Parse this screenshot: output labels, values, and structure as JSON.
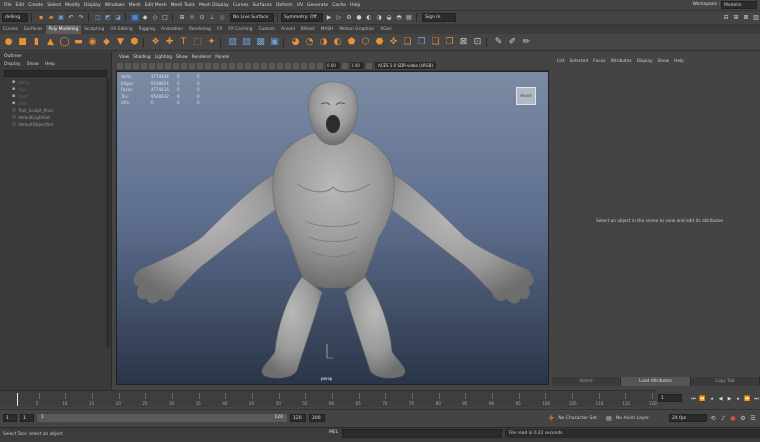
{
  "menubar": {
    "items": [
      "File",
      "Edit",
      "Create",
      "Select",
      "Modify",
      "Display",
      "Windows",
      "Mesh",
      "Edit Mesh",
      "Mesh Tools",
      "Mesh Display",
      "Curves",
      "Surfaces",
      "Deform",
      "UV",
      "Generate",
      "Cache",
      "Help"
    ],
    "workspace_label": "Workspace :",
    "workspace_value": "Modelin"
  },
  "statusline": {
    "mode": "delling",
    "live_surface": "No Live Surface",
    "symmetry": "Symmetry: Off",
    "sign_in": "Sign In"
  },
  "shelf_tabs": [
    "Curves",
    "Surfaces",
    "Poly Modeling",
    "Sculpting",
    "UV Editing",
    "Rigging",
    "Animation",
    "Rendering",
    "FX",
    "FX Caching",
    "Custom",
    "Arnold",
    "Bifrost",
    "MASH",
    "Motion Graphics",
    "XGen"
  ],
  "shelf_active": "Poly Modeling",
  "outliner": {
    "title": "Outliner",
    "menu": [
      "Display",
      "Show",
      "Help"
    ],
    "items": [
      {
        "label": "persp",
        "dim": true
      },
      {
        "label": "top",
        "dim": true
      },
      {
        "label": "front",
        "dim": true
      },
      {
        "label": "side",
        "dim": true
      },
      {
        "label": "Troll_Sculpt_final",
        "dim": false
      },
      {
        "label": "defaultLightSet",
        "dim": false
      },
      {
        "label": "defaultObjectSet",
        "dim": false
      }
    ]
  },
  "viewport": {
    "menu": [
      "View",
      "Shading",
      "Lighting",
      "Show",
      "Renderer",
      "Panels"
    ],
    "field1": "0.00",
    "field2": "1.00",
    "camera": "ACES 1.0 SDR-video (sRGB)",
    "hud": [
      {
        "label": "Verts:",
        "value": "4774404",
        "sel": "0",
        "z": "0"
      },
      {
        "label": "Edges:",
        "value": "9548824",
        "sel": "0",
        "z": "0"
      },
      {
        "label": "Faces:",
        "value": "4774416",
        "sel": "0",
        "z": "0"
      },
      {
        "label": "Tris:",
        "value": "9548832",
        "sel": "0",
        "z": "0"
      },
      {
        "label": "UVs:",
        "value": "0",
        "sel": "0",
        "z": "0"
      }
    ],
    "viewcube_label": "FRONT",
    "camera_label": "persp"
  },
  "attribute_editor": {
    "menu": [
      "List",
      "Selected",
      "Focus",
      "Attributes",
      "Display",
      "Show",
      "Help"
    ],
    "message": "Select an object in the scene to view and edit its attributes",
    "buttons": [
      "Select",
      "Load Attributes",
      "Copy Tab"
    ],
    "active_button": "Load Attributes"
  },
  "timeslider": {
    "ticks": [
      "5",
      "10",
      "15",
      "20",
      "25",
      "30",
      "35",
      "40",
      "45",
      "50",
      "55",
      "60",
      "65",
      "70",
      "75",
      "80",
      "85",
      "90",
      "95",
      "100",
      "105",
      "110",
      "115",
      "120"
    ],
    "current_frame": "1"
  },
  "playback_icons": [
    "first-frame-icon",
    "prev-key-icon",
    "prev-frame-icon",
    "play-back-icon",
    "play-forward-icon",
    "next-frame-icon",
    "next-key-icon",
    "last-frame-icon"
  ],
  "rangeslider": {
    "start": "1",
    "inner_start": "1",
    "range_label_left": "1",
    "range_label_right": "120",
    "inner_end": "120",
    "end": "200",
    "character_set": "No Character Set",
    "anim_layer": "No Anim Layer",
    "fps": "24 fps"
  },
  "commandline": {
    "help": "Select Tool: select an object",
    "mel_label": "MEL",
    "result": "File read in 0.22 seconds."
  },
  "colors": {
    "accent": "#5d5d5d",
    "icon_orange": "#e8903a",
    "icon_blue": "#6fa0d8",
    "viewport_top": "#7c8ba3",
    "viewport_bottom": "#2a3548"
  }
}
